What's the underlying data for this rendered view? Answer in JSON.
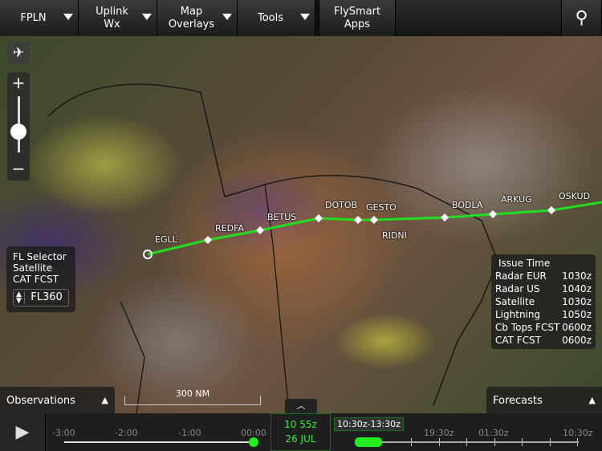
{
  "toolbar": {
    "fpln": "FPLN",
    "uplink": "Uplink\nWx",
    "map_overlays": "Map\nOverlays",
    "tools": "Tools",
    "flysmart": "FlySmart\nApps"
  },
  "route": {
    "waypoints": [
      "EGLL",
      "REDFA",
      "BETUS",
      "DOTOB",
      "GESTO",
      "RIDNI",
      "BODLA",
      "ARKUG",
      "OSKUD"
    ],
    "color": "#22dd22"
  },
  "fl_selector": {
    "title": "FL Selector",
    "line1": "Satellite",
    "line2": "CAT FCST",
    "value": "FL360"
  },
  "issue_time": {
    "title": "Issue Time",
    "rows": [
      {
        "label": "Radar EUR",
        "value": "1030z"
      },
      {
        "label": "Radar US",
        "value": "1040z"
      },
      {
        "label": "Satellite",
        "value": "1030z"
      },
      {
        "label": "Lightning",
        "value": "1050z"
      },
      {
        "label": "Cb Tops FCST",
        "value": "0600z"
      },
      {
        "label": "CAT FCST",
        "value": "0600z"
      }
    ]
  },
  "scale": "300 NM",
  "observations": "Observations",
  "forecasts": "Forecasts",
  "timeline": {
    "past_ticks": [
      "-3:00",
      "-2:00",
      "-1:00",
      "00:00"
    ],
    "current_time": "10 55z",
    "current_date": "26 JUL",
    "forecast_range": "10:30z-13:30z",
    "future_ticks": [
      "19:30z",
      "01:30z",
      "10:30z"
    ],
    "accent": "#22ee22",
    "past_progress": 1.0
  },
  "zoom_level": 0.55
}
